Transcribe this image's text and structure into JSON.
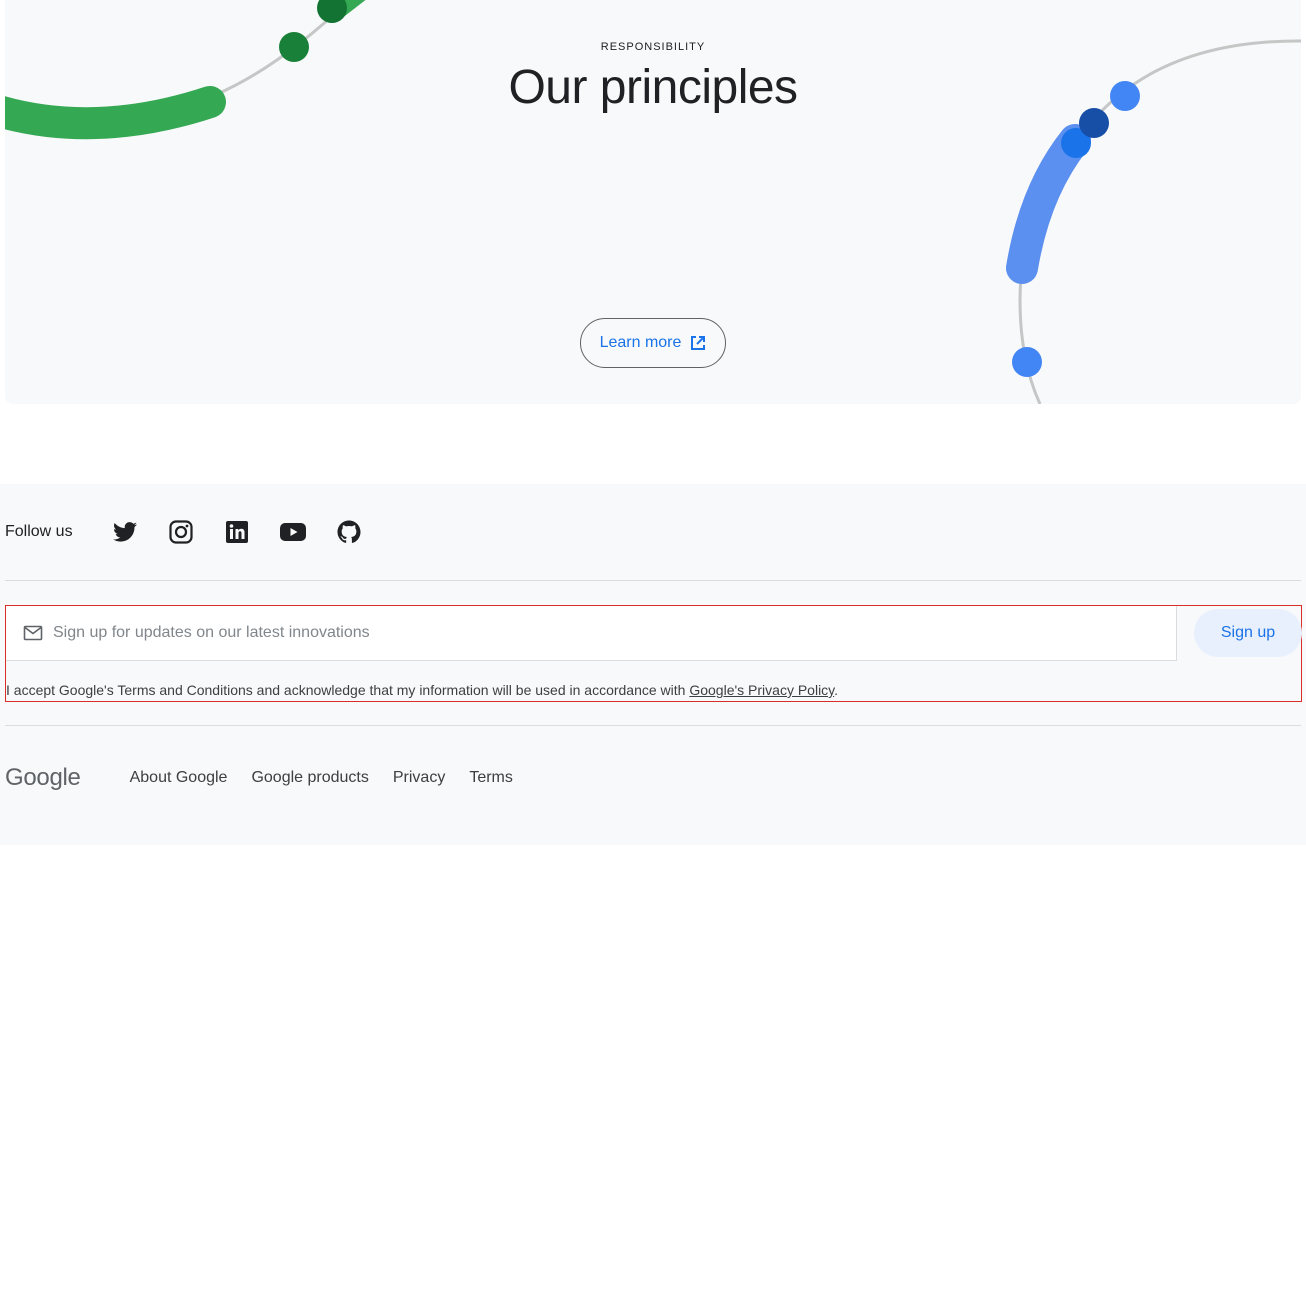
{
  "hero": {
    "eyebrow": "RESPONSIBILITY",
    "title": "Our principles",
    "learn_more_label": "Learn more",
    "learn_more_icon": "open-in-new-icon",
    "colors": {
      "background": "#f8f9fa",
      "green_arc": "#34a853",
      "green_dot": "#188038",
      "blue_arc": "#4285f4",
      "blue_dot": "#1a73e8",
      "link_blue": "#1a73e8"
    }
  },
  "footer": {
    "follow_label": "Follow us",
    "social": [
      {
        "icon": "twitter-icon"
      },
      {
        "icon": "instagram-icon"
      },
      {
        "icon": "linkedin-icon"
      },
      {
        "icon": "youtube-icon"
      },
      {
        "icon": "github-icon"
      }
    ],
    "signup": {
      "email_icon": "mail-icon",
      "placeholder": "Sign up for updates on our latest innovations",
      "value": "",
      "button_label": "Sign up",
      "consent_text": "I accept Google's Terms and Conditions and acknowledge that my information will be used in accordance with ",
      "consent_link": "Google's Privacy Policy",
      "consent_end": "."
    },
    "logo": "Google",
    "links": [
      "About Google",
      "Google products",
      "Privacy",
      "Terms"
    ]
  }
}
